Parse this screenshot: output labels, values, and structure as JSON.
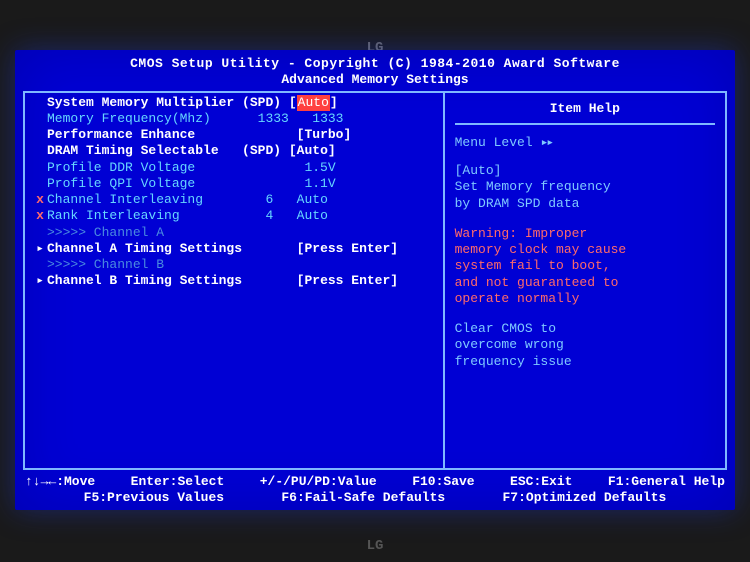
{
  "header": {
    "title": "CMOS Setup Utility - Copyright (C) 1984-2010 Award Software",
    "subtitle": "Advanced Memory Settings"
  },
  "settings": {
    "sys_mem_mult": {
      "label": "System Memory Multiplier",
      "hint": "(SPD)",
      "value": "Auto",
      "selected": true
    },
    "mem_freq": {
      "label": "Memory Frequency(Mhz)",
      "mid": "1333",
      "value": "1333"
    },
    "perf_enhance": {
      "label": "Performance Enhance",
      "value": "Turbo"
    },
    "dram_timing": {
      "label": "DRAM Timing Selectable",
      "hint": "(SPD)",
      "value": "Auto"
    },
    "ddr_voltage": {
      "label": "Profile DDR Voltage",
      "value": "1.5V"
    },
    "qpi_voltage": {
      "label": "Profile QPI Voltage",
      "value": "1.1V"
    },
    "ch_interleave": {
      "label": "Channel Interleaving",
      "mid": "6",
      "value": "Auto"
    },
    "rank_interleave": {
      "label": "Rank Interleaving",
      "mid": "4",
      "value": "Auto"
    },
    "sub_ch_a": {
      "label": ">>>>> Channel A"
    },
    "ch_a_timing": {
      "label": "Channel A Timing Settings",
      "value": "Press Enter"
    },
    "sub_ch_b": {
      "label": ">>>>> Channel B"
    },
    "ch_b_timing": {
      "label": "Channel B Timing Settings",
      "value": "Press Enter"
    }
  },
  "help": {
    "title": "Item Help",
    "menu_level": "Menu Level",
    "auto_label": "[Auto]",
    "desc1": "Set Memory frequency",
    "desc2": "by DRAM SPD data",
    "warn1": "Warning: Improper",
    "warn2": "memory clock may cause",
    "warn3": "system fail to boot,",
    "warn4": "and not guaranteed to",
    "warn5": "operate normally",
    "clr1": "Clear CMOS to",
    "clr2": "overcome wrong",
    "clr3": "frequency issue"
  },
  "footer": {
    "l1a": "↑↓→←:Move",
    "l1b": "Enter:Select",
    "l1c": "+/-/PU/PD:Value",
    "l1d": "F10:Save",
    "l1e": "ESC:Exit",
    "l1f": "F1:General Help",
    "l2a": "F5:Previous Values",
    "l2b": "F6:Fail-Safe Defaults",
    "l2c": "F7:Optimized Defaults"
  },
  "brand": {
    "logo": "LG"
  }
}
